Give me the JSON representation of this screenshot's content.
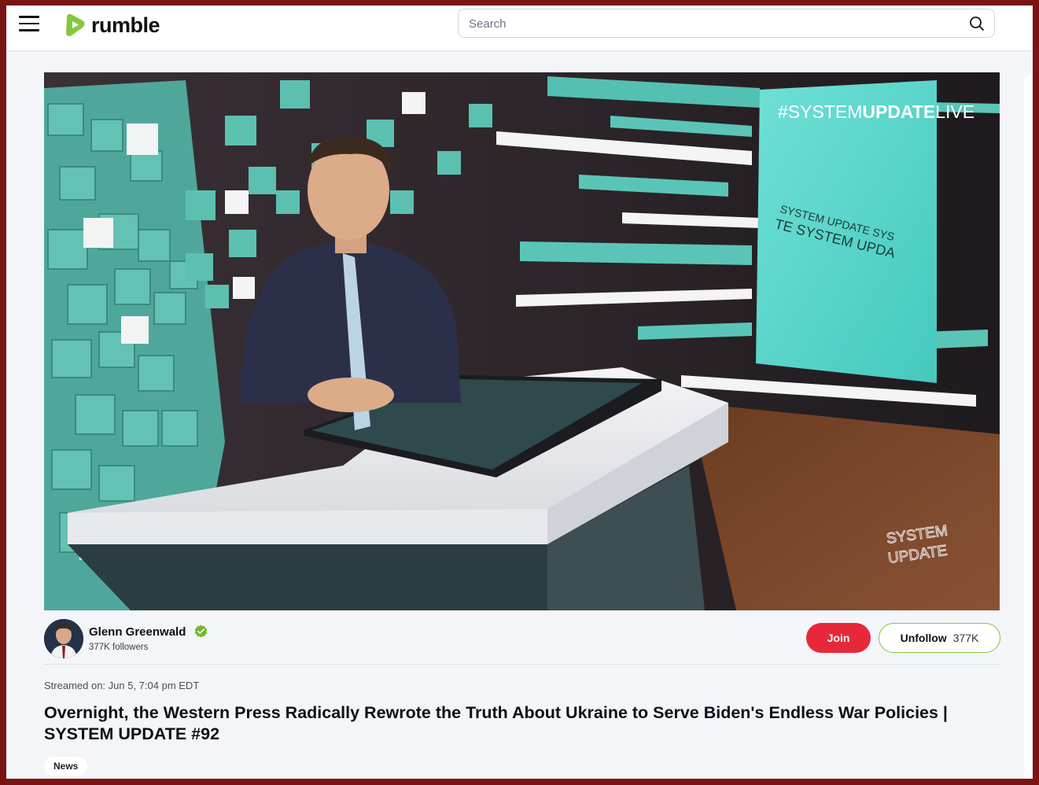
{
  "header": {
    "logo_text": "rumble",
    "search_placeholder": "Search"
  },
  "video": {
    "hashtag_prefix": "#SYSTEM",
    "hashtag_bold": "UPDATE",
    "hashtag_suffix": "LIVE",
    "screen_text_1": "SYSTEM UPDATE SYS",
    "screen_text_2": "TE SYSTEM UPDA",
    "watermark_1": "SYSTEM",
    "watermark_2": "UPDATE"
  },
  "channel": {
    "name": "Glenn Greenwald",
    "followers": "377K followers",
    "join_label": "Join",
    "unfollow_label": "Unfollow",
    "unfollow_count": "377K"
  },
  "meta": {
    "streamed": "Streamed on: Jun 5, 7:04 pm EDT",
    "title": "Overnight, the Western Press Radically Rewrote the Truth About Ukraine to Serve Biden's Endless War Policies | SYSTEM UPDATE #92",
    "tag": "News"
  },
  "colors": {
    "brand_green": "#85c742",
    "join_red": "#e6283a",
    "teal": "#5fc3b3"
  },
  "icons": [
    "hamburger-menu-icon",
    "rumble-logo-icon",
    "search-icon",
    "verified-check-icon"
  ]
}
